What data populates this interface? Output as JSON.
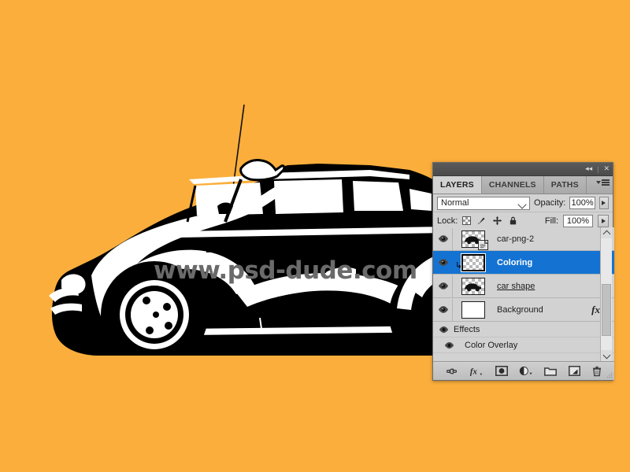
{
  "canvas": {
    "background_color": "#FBAE3C",
    "artwork_name": "vw-beetle-silhouette",
    "watermark": "www.psd-dude.com",
    "watermark_color": "#6a6a6a",
    "ink_color": "#000000",
    "highlight_color": "#ffffff"
  },
  "panel": {
    "titlebar": {
      "collapse_label": "◂◂",
      "separator": "|",
      "close_label": "✕"
    },
    "tabs": [
      {
        "label": "LAYERS",
        "active": true
      },
      {
        "label": "CHANNELS",
        "active": false
      },
      {
        "label": "PATHS",
        "active": false
      }
    ],
    "menu_icon": "panel-menu-icon",
    "blend": {
      "mode": "Normal",
      "opacity_label": "Opacity:",
      "opacity_value": "100%"
    },
    "lock": {
      "label": "Lock:",
      "icons": [
        "lock-transparency-icon",
        "lock-image-icon",
        "lock-position-icon",
        "lock-all-icon"
      ],
      "fill_label": "Fill:",
      "fill_value": "100%"
    },
    "layers": [
      {
        "name": "car-png-2",
        "visible": true,
        "selected": false,
        "thumb": "transparent",
        "thumb_badge": "smart-object-badge",
        "clipped": false,
        "underline": false,
        "fx": false
      },
      {
        "name": "Coloring",
        "visible": true,
        "selected": true,
        "thumb": "transparent",
        "thumb_badge": "",
        "clipped": true,
        "underline": false,
        "fx": false
      },
      {
        "name": "car shape",
        "visible": true,
        "selected": false,
        "thumb": "transparent",
        "thumb_badge": "",
        "clipped": false,
        "underline": true,
        "fx": false
      },
      {
        "name": "Background",
        "visible": true,
        "selected": false,
        "thumb": "white",
        "thumb_badge": "",
        "clipped": false,
        "underline": false,
        "fx": true,
        "fx_label": "fx"
      }
    ],
    "effects": [
      {
        "label": "Effects",
        "visible": true,
        "indent": false
      },
      {
        "label": "Color Overlay",
        "visible": true,
        "indent": true
      }
    ],
    "bottom_tools": [
      "link-layers-icon",
      "layer-style-fx-icon",
      "add-layer-mask-icon",
      "new-adjustment-layer-icon",
      "new-group-icon",
      "new-layer-icon",
      "delete-layer-icon"
    ],
    "scrollbar": {
      "up_icon": "scroll-up-icon",
      "down_icon": "scroll-down-icon"
    },
    "selection_color": "#1473d2"
  }
}
